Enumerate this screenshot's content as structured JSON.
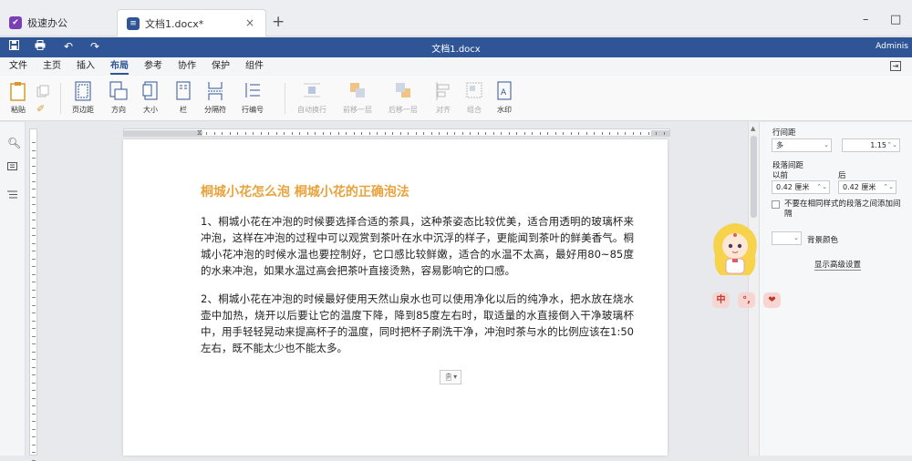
{
  "tabs": {
    "app_label": "极速办公",
    "doc_label": "文档1.docx*",
    "close": "×",
    "add": "+",
    "minimize": "–",
    "maximize": "□"
  },
  "titlebar": {
    "title": "文档1.docx",
    "user": "Adminis"
  },
  "menu": {
    "items": [
      "文件",
      "主页",
      "插入",
      "布局",
      "参考",
      "协作",
      "保护",
      "组件"
    ],
    "active": "布局"
  },
  "ribbon": {
    "paste": "粘贴",
    "margins": "页边距",
    "orientation": "方向",
    "size": "大小",
    "columns": "栏",
    "breaks": "分隔符",
    "line_numbers": "行编号",
    "wrap": "自动换行",
    "bring_forward": "前移一层",
    "send_backward": "后移一层",
    "align": "对齐",
    "group": "组合",
    "watermark": "水印"
  },
  "document": {
    "heading": "桐城小花怎么泡 桐城小花的正确泡法",
    "paragraph1": "1、桐城小花在冲泡的时候要选择合适的茶具，这种茶姿态比较优美，适合用透明的玻璃杯来冲泡，这样在冲泡的过程中可以观赏到茶叶在水中沉浮的样子，更能闻到茶叶的鲜美香气。桐城小花冲泡的时候水温也要控制好，它口感比较鲜嫩，适合的水温不太高，最好用80~85度的水来冲泡，如果水温过高会把茶叶直接烫熟，容易影响它的口感。",
    "paragraph2": "2、桐城小花在冲泡的时候最好使用天然山泉水也可以使用净化以后的纯净水，把水放在烧水壶中加热，烧开以后要让它的温度下降，降到85度左右时，取适量的水直接倒入干净玻璃杯中，用手轻轻晃动来提高杯子的温度，同时把杯子刷洗干净，冲泡时茶与水的比例应该在1:50左右，既不能太少也不能太多。"
  },
  "ruler": {
    "corner": "L"
  },
  "panel": {
    "line_spacing_label": "行间距",
    "line_spacing_mode": "多",
    "line_spacing_value": "1.15",
    "para_spacing_label": "段落间距",
    "before_label": "以前",
    "after_label": "后",
    "before_value": "0.42 厘米",
    "after_value": "0.42 厘米",
    "no_space_checkbox": "不要在相同样式的段落之间添加间隔",
    "bg_color_label": "背景颜色",
    "advanced_link": "显示高级设置"
  },
  "ime": {
    "lang": "中",
    "punct": "°,",
    "heart": "❤"
  },
  "colors": {
    "brand": "#2f5597",
    "heading": "#e8a33c"
  }
}
